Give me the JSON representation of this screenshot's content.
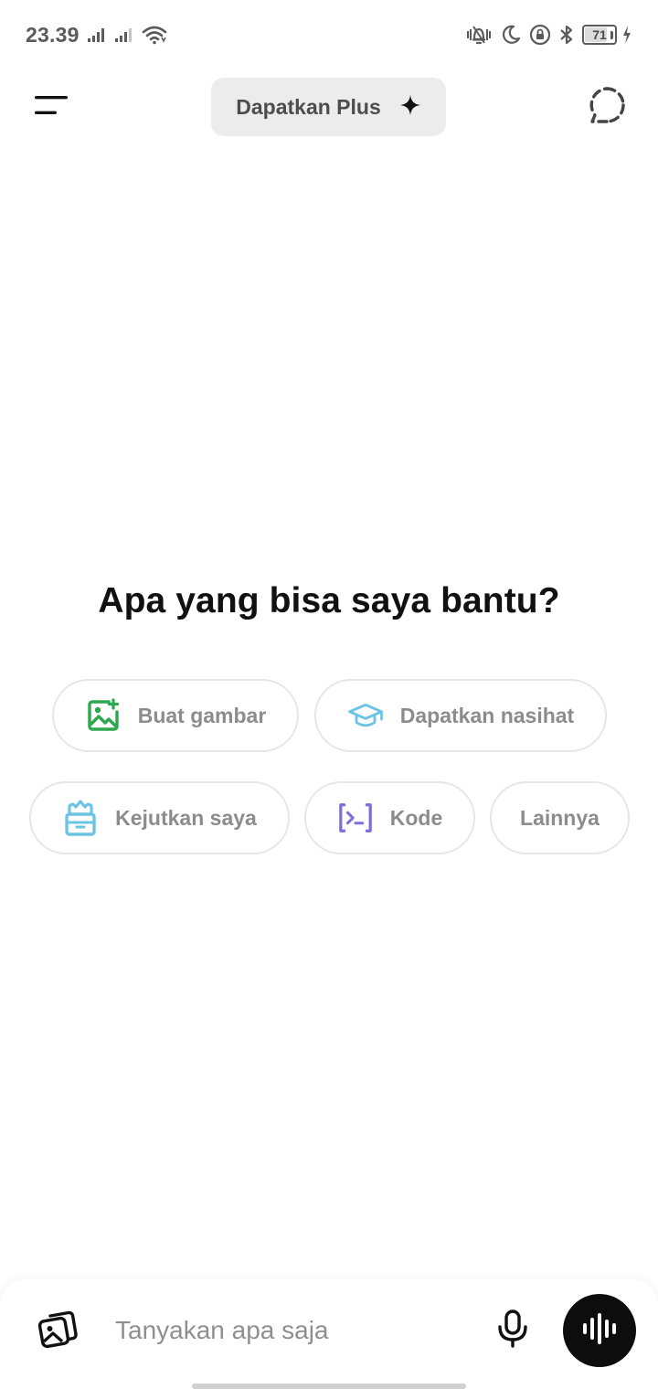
{
  "status_bar": {
    "time": "23.39",
    "battery_level": "71",
    "icons": [
      "signal-icon",
      "signal-icon",
      "wifi-icon",
      "vibrate-icon",
      "moon-icon",
      "rotation-lock-icon",
      "bluetooth-icon",
      "battery-icon",
      "charging-icon"
    ]
  },
  "header": {
    "upgrade_label": "Dapatkan Plus",
    "icons": [
      "menu-icon",
      "sparkle-icon",
      "new-chat-icon"
    ]
  },
  "main": {
    "title": "Apa yang bisa saya bantu?",
    "suggestions": [
      {
        "label": "Buat gambar",
        "icon": "image-create-icon",
        "color": "#2ea84f"
      },
      {
        "label": "Dapatkan nasihat",
        "icon": "graduation-cap-icon",
        "color": "#6cc4e4"
      },
      {
        "label": "Kejutkan saya",
        "icon": "gift-box-icon",
        "color": "#6cc4e4"
      },
      {
        "label": "Kode",
        "icon": "code-icon",
        "color": "#7b6fe0"
      },
      {
        "label": "Lainnya",
        "icon": "",
        "color": ""
      }
    ]
  },
  "composer": {
    "placeholder": "Tanyakan apa saja",
    "value": "",
    "icons": [
      "attach-image-icon",
      "microphone-icon",
      "voice-mode-icon"
    ]
  },
  "colors": {
    "background": "#ffffff",
    "chip_border": "#e7e7e7",
    "chip_text": "#8c8c8c",
    "upgrade_bg": "#ececec",
    "voice_button": "#0d0d0d"
  }
}
